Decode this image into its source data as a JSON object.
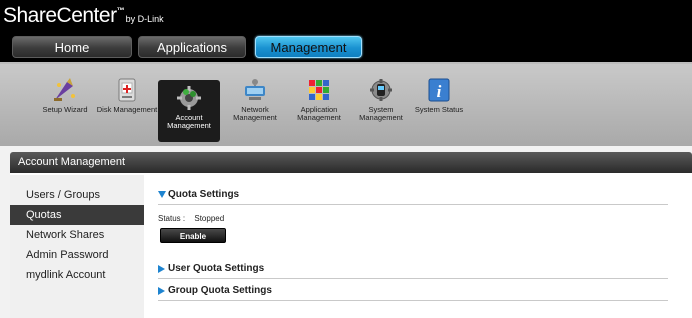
{
  "brand": {
    "name": "ShareCenter",
    "tm": "™",
    "by": "by D-Link"
  },
  "top_nav": [
    {
      "label": "Home"
    },
    {
      "label": "Applications"
    },
    {
      "label": "Management"
    }
  ],
  "toolbar": {
    "items": [
      {
        "label": "Setup Wizard",
        "icon": "wizard-icon"
      },
      {
        "label": "Disk Management",
        "icon": "disk-icon"
      },
      {
        "label": "Account Management",
        "icon": "account-icon",
        "active": true
      },
      {
        "label": "Network Management",
        "icon": "network-icon"
      },
      {
        "label": "Application Management",
        "icon": "application-icon"
      },
      {
        "label": "System Management",
        "icon": "system-icon"
      },
      {
        "label": "System Status",
        "icon": "info-icon"
      }
    ]
  },
  "panel": {
    "title": "Account Management"
  },
  "sidebar": {
    "items": [
      {
        "label": "Users / Groups"
      },
      {
        "label": "Quotas",
        "active": true
      },
      {
        "label": "Network Shares"
      },
      {
        "label": "Admin Password"
      },
      {
        "label": "mydlink Account"
      }
    ]
  },
  "main": {
    "quota_settings": {
      "title": "Quota Settings",
      "status_label": "Status :",
      "status_value": "Stopped",
      "enable_label": "Enable"
    },
    "user_quota": {
      "title": "User Quota Settings"
    },
    "group_quota": {
      "title": "Group Quota Settings"
    }
  },
  "colors": {
    "accent": "#1e84d0",
    "active_tab": "#1a92d1",
    "header_bg": "#000000"
  }
}
